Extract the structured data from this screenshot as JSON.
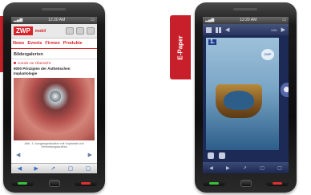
{
  "left_phone": {
    "status_time": "12:20 AM",
    "logo": "ZWP",
    "logo_sub": "mobil",
    "nav_tabs": [
      "News",
      "Events",
      "Firmen",
      "Produkte"
    ],
    "gallery_title": "Bildergalerien",
    "back_link": "zurück zur Übersicht",
    "article_title": "9000 Prinzipien der Ästhetischen Implantologie",
    "caption": "Abb. 1: Ausgangssituation mit Implantat und Verbindungsaufbau",
    "pager_prev": "◀",
    "pager_next": "▶",
    "bottom_bar": [
      "◀",
      "▶",
      "↗",
      "▢",
      "▢"
    ]
  },
  "right_phone": {
    "status_time": "12:20 AM",
    "page_count": "1/56",
    "page_number": "1.",
    "page_logo": "ZWP",
    "bottom_bar": [
      "◀",
      "▶",
      "↗",
      "▢",
      "▢"
    ]
  },
  "epaper_label": "E-Paper",
  "colors": {
    "accent": "#d8232a",
    "epaper_bg": "#1c2a55"
  }
}
